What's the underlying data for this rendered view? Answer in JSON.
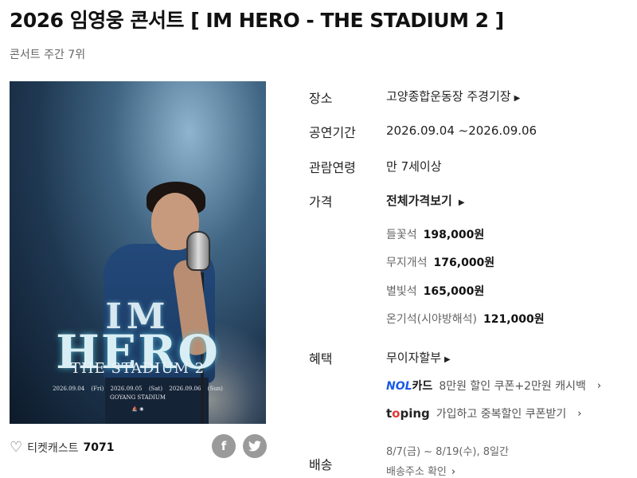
{
  "header": {
    "title": "2026 임영웅 콘서트 [ IM HERO - THE STADIUM 2 ]",
    "subtitle": "콘서트 주간 7위"
  },
  "poster": {
    "logo_line1": "IM",
    "logo_line2": "HERO",
    "logo_line3": "THE STADIUM 2",
    "dates": "2026.09.04 (Fri) 2026.09.05 (Sat) 2026.09.06 (Sun)",
    "venue": "GOYANG STADIUM"
  },
  "footer_left": {
    "heart_icon": "heart-outline-icon",
    "label": "티켓캐스트",
    "count": "7071",
    "facebook_glyph": "f",
    "twitter_glyph": "🐦"
  },
  "info": {
    "venue_label": "장소",
    "venue_value": "고양종합운동장 주경기장",
    "period_label": "공연기간",
    "period_value": "2026.09.04 ~2026.09.06",
    "age_label": "관람연령",
    "age_value": "만 7세이상",
    "price_label": "가격",
    "price_all": "전체가격보기",
    "prices": [
      {
        "seat": "들꽃석",
        "amount": "198,000원"
      },
      {
        "seat": "무지개석",
        "amount": "176,000원"
      },
      {
        "seat": "별빛석",
        "amount": "165,000원"
      },
      {
        "seat": "온기석(시야방해석)",
        "amount": "121,000원"
      }
    ],
    "benefit_label": "혜택",
    "benefit_value": "무이자할부",
    "nol_brand_a": "NOL",
    "nol_brand_b": "카드",
    "nol_text": "8만원 할인 쿠폰+2만원 캐시백",
    "toping_brand_a": "t",
    "toping_brand_o": "o",
    "toping_brand_b": "ping",
    "toping_text": "가입하고 중복할인 쿠폰받기",
    "delivery_label": "배송",
    "delivery_period": "8/7(금) ~ 8/19(수), 8일간",
    "delivery_check": "배송주소 확인"
  },
  "colors": {
    "nol_blue": "#1a5ae6",
    "toping_red": "#e53935",
    "share_gray": "#9a9a9a"
  }
}
